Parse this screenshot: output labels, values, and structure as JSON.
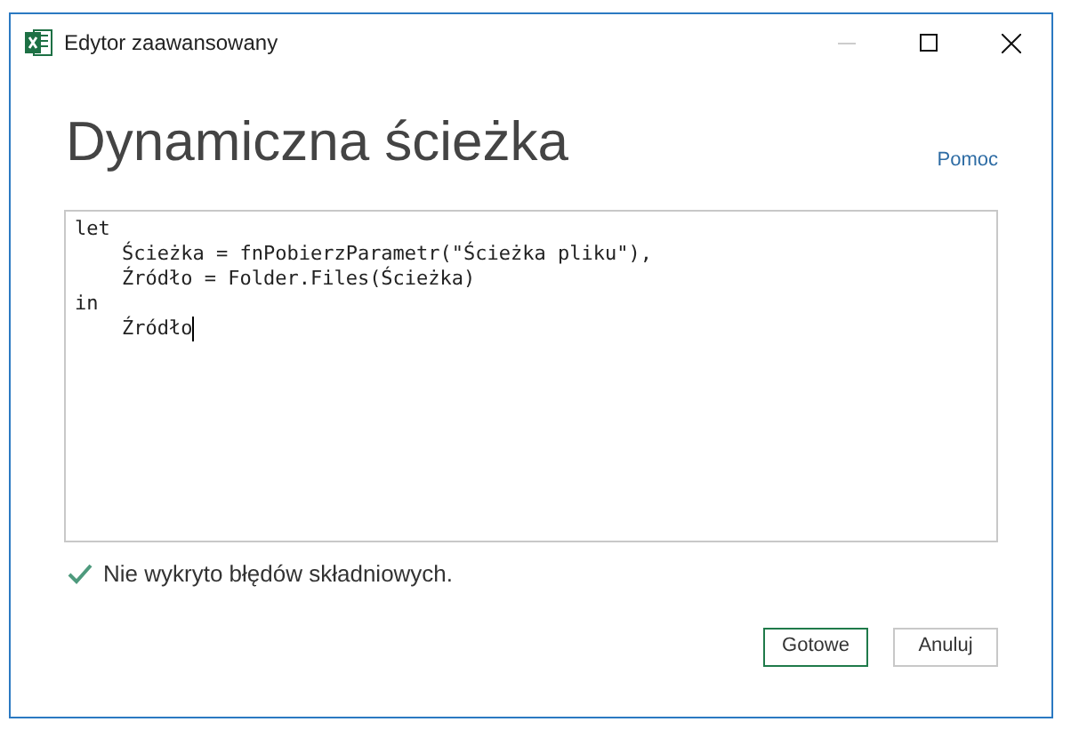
{
  "window": {
    "title": "Edytor zaawansowany"
  },
  "heading": "Dynamiczna ścieżka",
  "help_link": "Pomoc",
  "code_lines": [
    "let",
    "    Ścieżka = fnPobierzParametr(\"Ścieżka pliku\"),",
    "    Źródło = Folder.Files(Ścieżka)",
    "in",
    "    Źródło"
  ],
  "status": {
    "ok": true,
    "text": "Nie wykryto błędów składniowych."
  },
  "buttons": [
    {
      "label": "Gotowe",
      "primary": true
    },
    {
      "label": "Anuluj",
      "primary": false
    }
  ]
}
